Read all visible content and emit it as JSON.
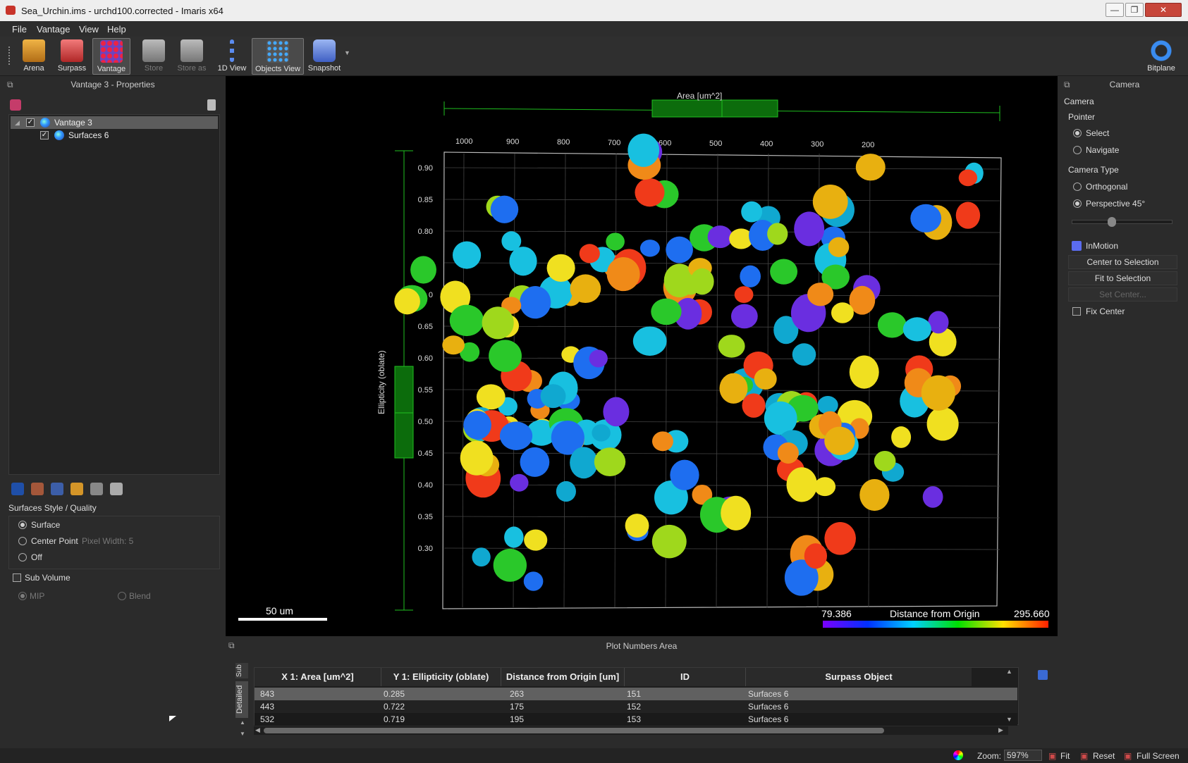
{
  "window": {
    "title": "Sea_Urchin.ims - urchd100.corrected - Imaris x64",
    "controls": {
      "minimize": "—",
      "maximize": "❐",
      "close": "✕"
    }
  },
  "menu": [
    "File",
    "Vantage",
    "View",
    "Help"
  ],
  "toolbar": {
    "buttons": [
      {
        "label": "Arena",
        "icon": "arena-icon",
        "color": "#d7952a"
      },
      {
        "label": "Surpass",
        "icon": "surpass-icon",
        "color": "#d84a4a"
      },
      {
        "label": "Vantage",
        "icon": "vantage-icon",
        "color": "#8e5ed6",
        "active": true
      },
      {
        "label": "Store",
        "icon": "store-icon",
        "color": "#8a8a8a",
        "disabled": true
      },
      {
        "label": "Store as",
        "icon": "store-as-icon",
        "color": "#8a8a8a",
        "disabled": true
      },
      {
        "label": "1D View",
        "icon": "1d-view-icon",
        "color": "#4a7bd8"
      },
      {
        "label": "Objects View",
        "icon": "objects-view-icon",
        "color": "#6a6a6a",
        "active": true
      },
      {
        "label": "Snapshot",
        "icon": "camera-icon",
        "color": "#5a7ad6"
      }
    ],
    "bitplane_label": "Bitplane"
  },
  "left": {
    "header": "Vantage 3 - Properties",
    "tree": [
      {
        "label": "Vantage 3",
        "checked": true,
        "selected": true
      },
      {
        "label": "Surfaces 6",
        "checked": true,
        "selected": false
      }
    ],
    "style_title": "Surfaces Style / Quality",
    "style_options": [
      {
        "label": "Surface",
        "on": true
      },
      {
        "label": "Center Point",
        "on": false
      },
      {
        "label": "Off",
        "on": false
      }
    ],
    "pixel_width": "Pixel Width:  5",
    "sub_volume": "Sub Volume",
    "mip": "MIP",
    "blend": "Blend"
  },
  "viewport": {
    "top_axis_label": "Area [um^2]",
    "left_axis_label": "Ellipticity (oblate)",
    "x_ticks": [
      "1000",
      "900",
      "800",
      "700",
      "600",
      "500",
      "400",
      "300",
      "200"
    ],
    "y_ticks": [
      "0.90",
      "0.85",
      "0.80",
      "0.75",
      "0",
      "0.65",
      "0.60",
      "0.55",
      "0.50",
      "0.45",
      "0.40",
      "0.35",
      "0.30"
    ],
    "scale_bar": "50 um",
    "colorbar": {
      "min": "79.386",
      "label": "Distance from Origin",
      "max": "295.660"
    }
  },
  "right": {
    "header": "Camera",
    "section": "Camera",
    "pointer_label": "Pointer",
    "pointer_options": [
      {
        "label": "Select",
        "on": true
      },
      {
        "label": "Navigate",
        "on": false
      }
    ],
    "camera_type_label": "Camera Type",
    "camera_type_options": [
      {
        "label": "Orthogonal",
        "on": false
      },
      {
        "label": "Perspective 45°",
        "on": true
      }
    ],
    "perspective_slider": 0.38,
    "inmotion": "InMotion",
    "buttons": [
      "Center to Selection",
      "Fit to Selection",
      "Set Center..."
    ],
    "fix_center": "Fix Center"
  },
  "table": {
    "header": "Plot Numbers Area",
    "side_tabs": [
      "Sub",
      "Detailed"
    ],
    "columns": [
      "X 1: Area [um^2]",
      "Y 1: Ellipticity (oblate)",
      "Distance from Origin [um]",
      "ID",
      "Surpass Object"
    ],
    "rows": [
      [
        "843",
        "0.285",
        "263",
        "151",
        "Surfaces 6"
      ],
      [
        "443",
        "0.722",
        "175",
        "152",
        "Surfaces 6"
      ],
      [
        "532",
        "0.719",
        "195",
        "153",
        "Surfaces 6"
      ]
    ]
  },
  "status": {
    "zoom_label": "Zoom:",
    "zoom_value": "597%",
    "fit": "Fit",
    "reset": "Reset",
    "fullscreen": "Full Screen"
  }
}
